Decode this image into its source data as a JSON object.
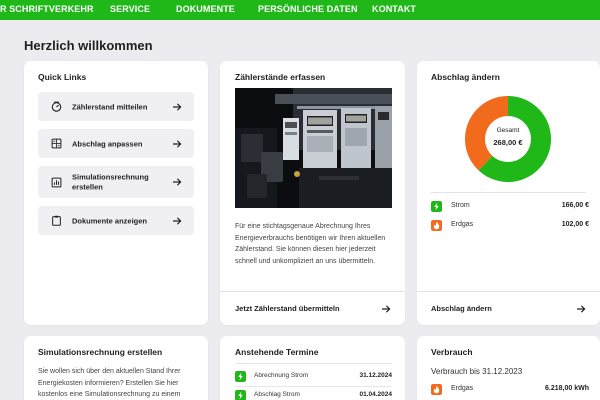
{
  "nav": {
    "items": [
      "R SCHRIFTVERKEHR",
      "SERVICE",
      "DOKUMENTE",
      "PERSÖNLICHE DATEN",
      "KONTAKT"
    ]
  },
  "welcome": "Herzlich willkommen",
  "quick_links": {
    "title": "Quick Links",
    "items": [
      {
        "label": "Zählerstand mitteilen",
        "icon": "meter-gauge-icon"
      },
      {
        "label": "Abschlag anpassen",
        "icon": "calculator-icon"
      },
      {
        "label": "Simulationsrechnung erstellen",
        "icon": "bar-chart-icon"
      },
      {
        "label": "Dokumente anzeigen",
        "icon": "clipboard-icon"
      }
    ]
  },
  "meter_card": {
    "title": "Zählerstände erfassen",
    "description": "Für eine stichtagsgenaue Abrechnung Ihres Energieverbrauchs benötigen wir Ihren aktuellen Zählerstand. Sie können diesen hier jederzeit schnell und unkompliziert an uns übermitteln.",
    "link": "Jetzt Zählerstand übermitteln"
  },
  "installment_card": {
    "title": "Abschlag ändern",
    "donut_label": "Gesamt",
    "donut_total": "268,00 €",
    "donut_values": [
      166.0,
      102.0
    ],
    "colors": {
      "strom": "#1fb818",
      "erdgas": "#f26a1b"
    },
    "rows": [
      {
        "label": "Strom",
        "value": "166,00 €",
        "icon": "lightning-icon"
      },
      {
        "label": "Erdgas",
        "value": "102,00 €",
        "icon": "flame-icon"
      }
    ],
    "link": "Abschlag ändern"
  },
  "simulation_card": {
    "title": "Simulationsrechnung erstellen",
    "text": "Sie wollen sich über den aktuellen Stand Ihrer Energiekosten informieren? Erstellen Sie hier kostenlos eine Simulationsrechnung zu einem"
  },
  "appointments_card": {
    "title": "Anstehende Termine",
    "rows": [
      {
        "label": "Abrechnung Strom",
        "date": "31.12.2024",
        "icon": "lightning-icon"
      },
      {
        "label": "Abschlag Strom",
        "date": "01.04.2024",
        "icon": "lightning-icon"
      }
    ]
  },
  "consumption_card": {
    "title": "Verbrauch",
    "subtitle": "Verbrauch bis 31.12.2023",
    "rows": [
      {
        "label": "Erdgas",
        "value": "6.218,00 kWh",
        "icon": "flame-icon"
      }
    ]
  }
}
